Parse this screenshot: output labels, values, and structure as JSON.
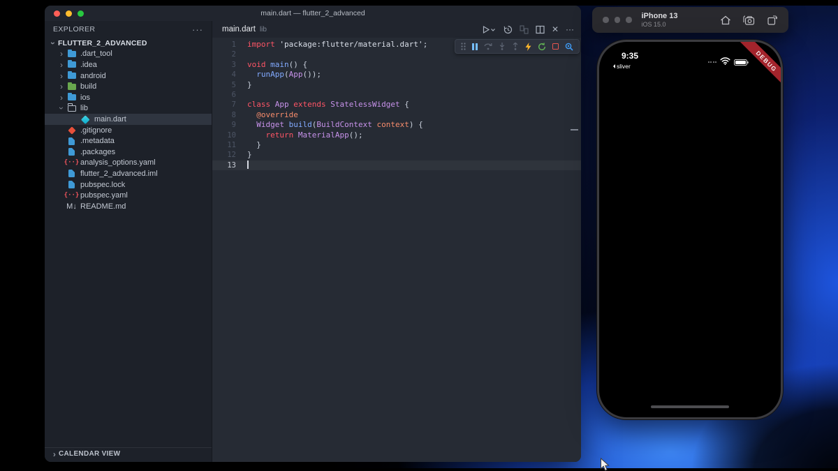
{
  "window": {
    "title": "main.dart — flutter_2_advanced"
  },
  "explorer": {
    "header": "EXPLORER",
    "root": "FLUTTER_2_ADVANCED",
    "items": [
      {
        "label": ".dart_tool",
        "icon": "folder",
        "chevron": "collapsed",
        "indent": 0,
        "selected": false
      },
      {
        "label": ".idea",
        "icon": "folder",
        "chevron": "collapsed",
        "indent": 0,
        "selected": false
      },
      {
        "label": "android",
        "icon": "folder",
        "chevron": "collapsed",
        "indent": 0,
        "selected": false
      },
      {
        "label": "build",
        "icon": "folder-build",
        "chevron": "collapsed",
        "indent": 0,
        "selected": false
      },
      {
        "label": "ios",
        "icon": "folder",
        "chevron": "collapsed",
        "indent": 0,
        "selected": false
      },
      {
        "label": "lib",
        "icon": "folder-open",
        "chevron": "expanded",
        "indent": 0,
        "selected": false
      },
      {
        "label": "main.dart",
        "icon": "dart",
        "chevron": "none",
        "indent": 1,
        "selected": true
      },
      {
        "label": ".gitignore",
        "icon": "git",
        "chevron": "none",
        "indent": 0,
        "selected": false
      },
      {
        "label": ".metadata",
        "icon": "file",
        "chevron": "none",
        "indent": 0,
        "selected": false
      },
      {
        "label": ".packages",
        "icon": "file",
        "chevron": "none",
        "indent": 0,
        "selected": false
      },
      {
        "label": "analysis_options.yaml",
        "icon": "yaml",
        "chevron": "none",
        "indent": 0,
        "selected": false
      },
      {
        "label": "flutter_2_advanced.iml",
        "icon": "file",
        "chevron": "none",
        "indent": 0,
        "selected": false
      },
      {
        "label": "pubspec.lock",
        "icon": "file",
        "chevron": "none",
        "indent": 0,
        "selected": false
      },
      {
        "label": "pubspec.yaml",
        "icon": "yaml",
        "chevron": "none",
        "indent": 0,
        "selected": false
      },
      {
        "label": "README.md",
        "icon": "markdown",
        "chevron": "none",
        "indent": 0,
        "selected": false
      }
    ],
    "bottom_section": "CALENDAR VIEW"
  },
  "editor": {
    "tab": {
      "name": "main.dart",
      "detail": "lib"
    },
    "active_line": 13,
    "code": [
      {
        "n": 1,
        "tokens": [
          [
            "kw",
            "import"
          ],
          [
            "pl",
            " "
          ],
          [
            "str",
            "'package:flutter/material.dart'"
          ],
          [
            "pl",
            ";"
          ]
        ]
      },
      {
        "n": 2,
        "tokens": []
      },
      {
        "n": 3,
        "tokens": [
          [
            "kw",
            "void"
          ],
          [
            "pl",
            " "
          ],
          [
            "fn",
            "main"
          ],
          [
            "pl",
            "() {"
          ]
        ]
      },
      {
        "n": 4,
        "tokens": [
          [
            "pl",
            "  "
          ],
          [
            "fn",
            "runApp"
          ],
          [
            "pl",
            "("
          ],
          [
            "type",
            "App"
          ],
          [
            "pl",
            "());"
          ]
        ]
      },
      {
        "n": 5,
        "tokens": [
          [
            "pl",
            "}"
          ]
        ]
      },
      {
        "n": 6,
        "tokens": []
      },
      {
        "n": 7,
        "tokens": [
          [
            "kw",
            "class"
          ],
          [
            "pl",
            " "
          ],
          [
            "type",
            "App"
          ],
          [
            "pl",
            " "
          ],
          [
            "kw",
            "extends"
          ],
          [
            "pl",
            " "
          ],
          [
            "type",
            "StatelessWidget"
          ],
          [
            "pl",
            " {"
          ]
        ]
      },
      {
        "n": 8,
        "tokens": [
          [
            "pl",
            "  "
          ],
          [
            "ann",
            "@override"
          ]
        ]
      },
      {
        "n": 9,
        "tokens": [
          [
            "pl",
            "  "
          ],
          [
            "type",
            "Widget"
          ],
          [
            "pl",
            " "
          ],
          [
            "fn",
            "build"
          ],
          [
            "pl",
            "("
          ],
          [
            "type",
            "BuildContext"
          ],
          [
            "pl",
            " "
          ],
          [
            "param",
            "context"
          ],
          [
            "pl",
            ") {"
          ]
        ]
      },
      {
        "n": 10,
        "tokens": [
          [
            "pl",
            "    "
          ],
          [
            "kw",
            "return"
          ],
          [
            "pl",
            " "
          ],
          [
            "type",
            "MaterialApp"
          ],
          [
            "pl",
            "();"
          ]
        ]
      },
      {
        "n": 11,
        "tokens": [
          [
            "pl",
            "  }"
          ]
        ]
      },
      {
        "n": 12,
        "tokens": [
          [
            "pl",
            "}"
          ]
        ]
      },
      {
        "n": 13,
        "tokens": []
      }
    ],
    "action_icons": [
      "run-or-debug",
      "timeline",
      "compare-changes",
      "split-editor",
      "close",
      "more-actions"
    ]
  },
  "debug_toolbar": {
    "icons": [
      "drag-handle",
      "pause",
      "step-over",
      "step-into",
      "step-out",
      "hot-reload",
      "restart",
      "stop",
      "widget-inspector"
    ]
  },
  "simulator": {
    "window_title": "iPhone 13",
    "window_subtitle": "iOS 15.0",
    "statusbar": {
      "time": "9:35",
      "back_to_app": "sliver"
    },
    "debug_banner": "DEBUG"
  },
  "glyphs": {
    "chevron": "›",
    "more": "···",
    "close": "✕"
  },
  "colors": {
    "keyword": "#ff5566",
    "type": "#c792ea",
    "function": "#82aaff",
    "annotation": "#f78c6c",
    "param": "#f78c6c",
    "string": "#dadfe9",
    "plain": "#c9d0dc",
    "line_number": "#4d5565",
    "line_number_active": "#c9ced7",
    "editor_bg": "#262b34",
    "sidebar_bg": "#1d2129",
    "titlebar_bg": "#21252e",
    "selection_bg": "#2f3540",
    "accent_blue": "#3794ff",
    "debug_banner_red": "#a3242c",
    "hot_reload_yellow": "#ffb62c",
    "restart_green": "#62b455",
    "stop_red": "#e8564f",
    "pause_blue": "#75beff"
  }
}
